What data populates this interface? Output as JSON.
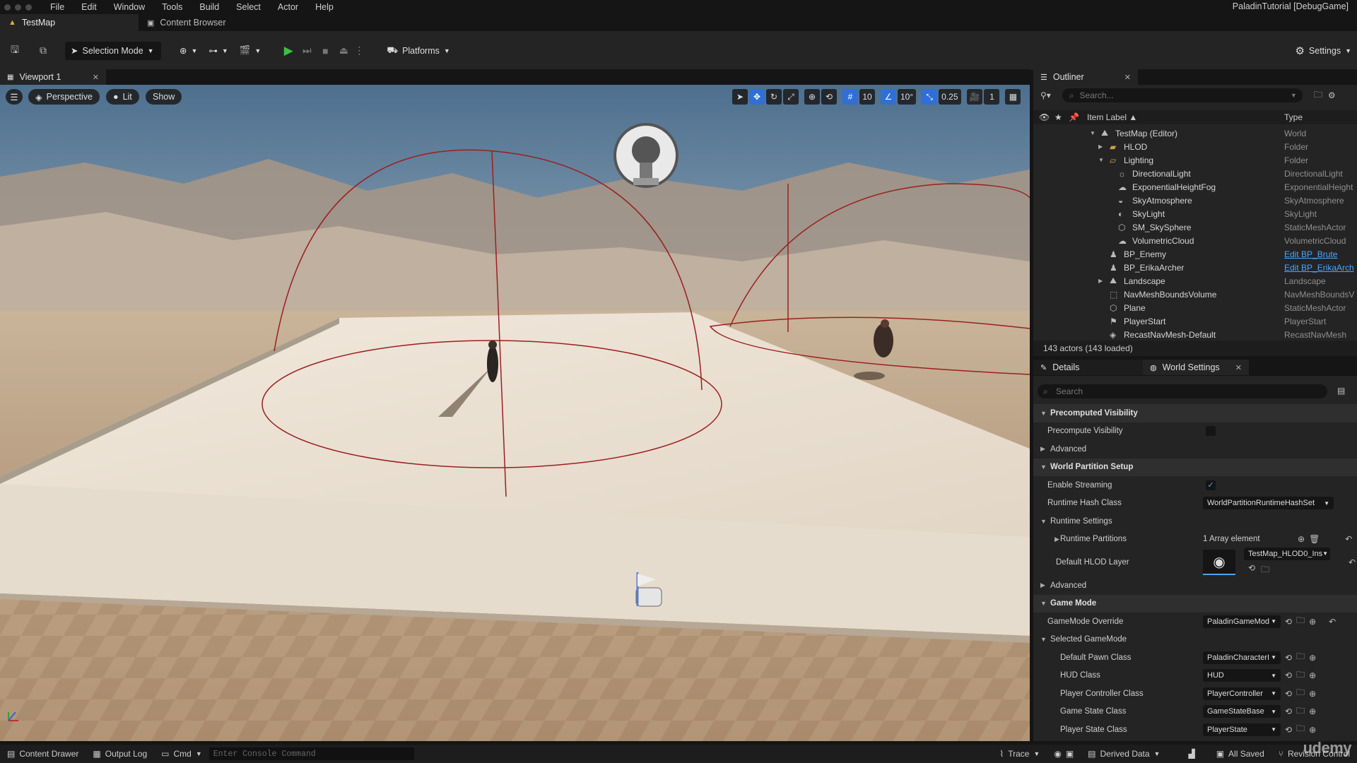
{
  "menubar": {
    "items": [
      "File",
      "Edit",
      "Window",
      "Tools",
      "Build",
      "Select",
      "Actor",
      "Help"
    ],
    "project_title": "PaladinTutorial [DebugGame]"
  },
  "tabs": {
    "level_tab": "TestMap",
    "content_browser_tab": "Content Browser"
  },
  "toolbar": {
    "selection_mode": "Selection Mode",
    "platforms": "Platforms",
    "settings": "Settings"
  },
  "viewport": {
    "tab": "Viewport 1",
    "view_mode": "Perspective",
    "lighting": "Lit",
    "show": "Show",
    "grid_snap": "10",
    "rotation_snap": "10°",
    "scale_snap": "0.25",
    "camera_speed": "1"
  },
  "outliner": {
    "tab": "Outliner",
    "search_placeholder": "Search...",
    "col_label": "Item Label ▲",
    "col_type": "Type",
    "rows": [
      {
        "label": "TestMap (Editor)",
        "type": "World",
        "indent": 0,
        "expand": "▼",
        "icon": "world-icon"
      },
      {
        "label": "HLOD",
        "type": "Folder",
        "indent": 1,
        "expand": "▶",
        "icon": "folder-icon"
      },
      {
        "label": "Lighting",
        "type": "Folder",
        "indent": 1,
        "expand": "▼",
        "icon": "folder-open-icon"
      },
      {
        "label": "DirectionalLight",
        "type": "DirectionalLight",
        "indent": 2,
        "expand": "",
        "icon": "directional-light-icon"
      },
      {
        "label": "ExponentialHeightFog",
        "type": "ExponentialHeight",
        "indent": 2,
        "expand": "",
        "icon": "fog-icon"
      },
      {
        "label": "SkyAtmosphere",
        "type": "SkyAtmosphere",
        "indent": 2,
        "expand": "",
        "icon": "sky-atmosphere-icon"
      },
      {
        "label": "SkyLight",
        "type": "SkyLight",
        "indent": 2,
        "expand": "",
        "icon": "skylight-icon"
      },
      {
        "label": "SM_SkySphere",
        "type": "StaticMeshActor",
        "indent": 2,
        "expand": "",
        "icon": "static-mesh-icon"
      },
      {
        "label": "VolumetricCloud",
        "type": "VolumetricCloud",
        "indent": 2,
        "expand": "",
        "icon": "cloud-icon"
      },
      {
        "label": "BP_Enemy",
        "type": "Edit BP_Brute",
        "indent": 1,
        "expand": "",
        "icon": "pawn-icon",
        "link": true
      },
      {
        "label": "BP_ErikaArcher",
        "type": "Edit BP_ErikaArch",
        "indent": 1,
        "expand": "",
        "icon": "pawn-icon",
        "link": true
      },
      {
        "label": "Landscape",
        "type": "Landscape",
        "indent": 1,
        "expand": "▶",
        "icon": "landscape-icon"
      },
      {
        "label": "NavMeshBoundsVolume",
        "type": "NavMeshBoundsV",
        "indent": 1,
        "expand": "",
        "icon": "volume-icon"
      },
      {
        "label": "Plane",
        "type": "StaticMeshActor",
        "indent": 1,
        "expand": "",
        "icon": "static-mesh-icon"
      },
      {
        "label": "PlayerStart",
        "type": "PlayerStart",
        "indent": 1,
        "expand": "",
        "icon": "player-start-icon"
      },
      {
        "label": "RecastNavMesh-Default",
        "type": "RecastNavMesh",
        "indent": 1,
        "expand": "",
        "icon": "navmesh-icon"
      }
    ],
    "count": "143 actors (143 loaded)"
  },
  "details": {
    "tab_details": "Details",
    "tab_world_settings": "World Settings",
    "search_placeholder": "Search",
    "rows": [
      {
        "kind": "cat",
        "name": "Precomputed Visibility",
        "indent": 0,
        "arrow": "▼"
      },
      {
        "kind": "prop",
        "name": "Precompute Visibility",
        "indent": 1,
        "control": "checkbox",
        "checked": false
      },
      {
        "kind": "sub",
        "name": "Advanced",
        "indent": 0,
        "arrow": "▶"
      },
      {
        "kind": "cat",
        "name": "World Partition Setup",
        "indent": 0,
        "arrow": "▼"
      },
      {
        "kind": "prop",
        "name": "Enable Streaming",
        "indent": 1,
        "control": "checkbox",
        "checked": true
      },
      {
        "kind": "prop",
        "name": "Runtime Hash Class",
        "indent": 1,
        "control": "dropdown",
        "value": "WorldPartitionRuntimeHashSet",
        "wide": true
      },
      {
        "kind": "sub",
        "name": "Runtime Settings",
        "indent": 0,
        "arrow": "▼"
      },
      {
        "kind": "prop",
        "name": "Runtime Partitions",
        "indent": 2,
        "arrow": "▶",
        "control": "array",
        "value": "1 Array element"
      },
      {
        "kind": "hlod",
        "name": "Default HLOD Layer",
        "indent": 1,
        "control": "asset",
        "value": "TestMap_HLOD0_Ins"
      },
      {
        "kind": "sub",
        "name": "Advanced",
        "indent": 0,
        "arrow": "▶"
      },
      {
        "kind": "cat",
        "name": "Game Mode",
        "indent": 0,
        "arrow": "▼"
      },
      {
        "kind": "prop",
        "name": "GameMode Override",
        "indent": 1,
        "control": "class",
        "value": "PaladinGameMod",
        "reset": true
      },
      {
        "kind": "sub",
        "name": "Selected GameMode",
        "indent": 0,
        "arrow": "▼"
      },
      {
        "kind": "prop",
        "name": "Default Pawn Class",
        "indent": 2,
        "control": "class",
        "value": "PaladinCharacterI"
      },
      {
        "kind": "prop",
        "name": "HUD Class",
        "indent": 2,
        "control": "class",
        "value": "HUD"
      },
      {
        "kind": "prop",
        "name": "Player Controller Class",
        "indent": 2,
        "control": "class",
        "value": "PlayerController"
      },
      {
        "kind": "prop",
        "name": "Game State Class",
        "indent": 2,
        "control": "class",
        "value": "GameStateBase"
      },
      {
        "kind": "prop",
        "name": "Player State Class",
        "indent": 2,
        "control": "class",
        "value": "PlayerState"
      }
    ]
  },
  "statusbar": {
    "content_drawer": "Content Drawer",
    "output_log": "Output Log",
    "cmd": "Cmd",
    "console_placeholder": "Enter Console Command",
    "trace": "Trace",
    "derived_data": "Derived Data",
    "all_saved": "All Saved",
    "revision_control": "Revision Control"
  },
  "watermark": "udemy",
  "colors": {
    "accent": "#2f6fd6",
    "play": "#3fbf3f",
    "panel": "#242424",
    "background": "#151515",
    "link": "#4aa6ff",
    "sphere": "#9a2020"
  }
}
